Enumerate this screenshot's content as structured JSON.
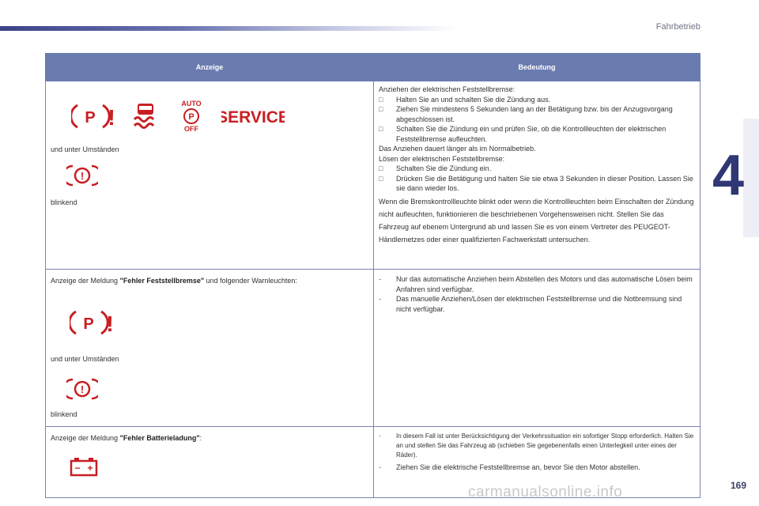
{
  "header": {
    "section_title": "Fahrbetrieb"
  },
  "chapter": {
    "number": "4"
  },
  "page": {
    "number": "169"
  },
  "watermark": "carmanualsonline.info",
  "table": {
    "headers": {
      "display": "Anzeige",
      "meaning": "Bedeutung"
    },
    "rows": [
      {
        "left": {
          "service_label": "SERVICE",
          "auto_label": "AUTO",
          "off_label": "OFF",
          "p_label": "P",
          "excl": "!",
          "under_circumstances": "und unter Umständen",
          "blinking": "blinkend"
        },
        "right": {
          "intro": "Anziehen der elektrischen Feststellbremse:",
          "bullets_1": [
            "Halten Sie an und schalten Sie die Zündung aus.",
            "Ziehen Sie mindestens 5 Sekunden lang an der Betätigung bzw. bis der Anzugsvorgang abgeschlossen ist.",
            "Schalten Sie die Zündung ein und prüfen Sie, ob die Kontrollleuchten der elektrischen Feststellbremse aufleuchten."
          ],
          "mid1": "Das Anziehen dauert länger als im Normalbetrieb.",
          "mid2": "Lösen der elektrischen Feststellbremse:",
          "bullets_2": [
            "Schalten Sie die Zündung ein.",
            "Drücken Sie die Betätigung und halten Sie sie etwa 3 Sekunden in dieser Position. Lassen Sie sie dann wieder los."
          ],
          "para": "Wenn die Bremskontrollleuchte blinkt oder wenn die Kontrollleuchten beim Einschalten der Zündung nicht aufleuchten, funktionieren die beschriebenen Vorgehensweisen nicht. Stellen Sie das Fahrzeug auf ebenem Untergrund ab und lassen Sie es von einem Vertreter des PEUGEOT-Händlernetzes oder einer qualifizierten Fachwerkstatt untersuchen."
        }
      },
      {
        "left": {
          "prefix": "Anzeige der Meldung ",
          "message": "\"Fehler Feststellbremse\"",
          "suffix": " und folgender Warnleuchten:",
          "under_circumstances": "und unter Umständen",
          "blinking": "blinkend"
        },
        "right": {
          "items": [
            "Nur das automatische Anziehen beim Abstellen des Motors und das automatische Lösen beim Anfahren sind verfügbar.",
            "Das manuelle Anziehen/Lösen der elektrischen Feststellbremse und die Notbremsung sind nicht verfügbar."
          ]
        }
      },
      {
        "left": {
          "prefix": "Anzeige der Meldung ",
          "message": "\"Fehler Batterieladung\"",
          "suffix": ":",
          "minus": "−",
          "plus": "+"
        },
        "right": {
          "items": [
            "In diesem Fall ist unter Berücksichtigung der Verkehrssituation ein sofortiger Stopp erforderlich. Halten Sie an und stellen Sie das Fahrzeug ab (schieben Sie gegebenenfalls einen Unterlegkeil unter eines der Räder).",
            "Ziehen Sie die elektrische Feststellbremse an, bevor Sie den Motor abstellen."
          ]
        }
      }
    ]
  },
  "colors": {
    "warning_red": "#c81e22",
    "header_blue": "#6a7bb0",
    "accent_navy": "#2f3775"
  }
}
